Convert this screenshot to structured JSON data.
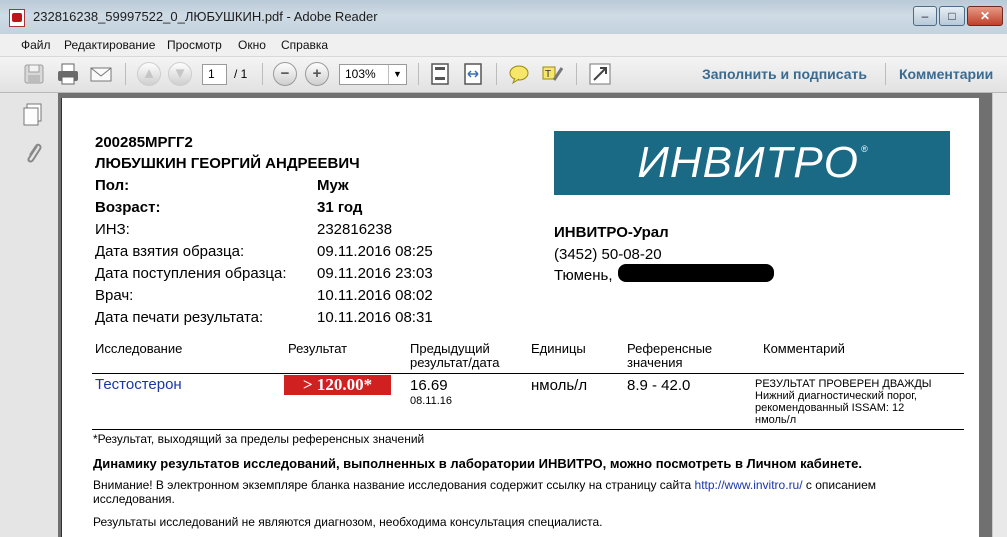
{
  "window": {
    "title": "232816238_59997522_0_ЛЮБУШКИН.pdf - Adobe Reader"
  },
  "menu": [
    "Файл",
    "Редактирование",
    "Просмотр",
    "Окно",
    "Справка"
  ],
  "toolbar": {
    "page_current": "1",
    "page_total": "/ 1",
    "zoom": "103%",
    "fill_sign": "Заполнить и подписать",
    "comments": "Комментарии"
  },
  "report": {
    "id": "200285МРГГ2",
    "patient": "ЛЮБУШКИН ГЕОРГИЙ АНДРЕЕВИЧ",
    "fields": [
      {
        "label": "Пол:",
        "value": "Муж",
        "bold": true
      },
      {
        "label": "Возраст:",
        "value": "31 год",
        "bold": true
      },
      {
        "label": "ИНЗ:",
        "value": "232816238",
        "bold": false
      },
      {
        "label": "Дата взятия образца:",
        "value": "09.11.2016 08:25",
        "bold": false
      },
      {
        "label": "Дата поступления образца:",
        "value": "09.11.2016 23:03",
        "bold": false
      },
      {
        "label": "Врач:",
        "value": "10.11.2016 08:02",
        "bold": false
      },
      {
        "label": "Дата печати результата:",
        "value": "10.11.2016 08:31",
        "bold": false
      }
    ],
    "logo_text": "ИНВИТРО",
    "logo_mark": "®",
    "lab": {
      "name": "ИНВИТРО-Урал",
      "phone": "(3452) 50-08-20",
      "city": "Тюмень,"
    },
    "table_headers": {
      "test": "Исследование",
      "result": "Результат",
      "prev_1": "Предыдущий",
      "prev_2": "результат/дата",
      "units": "Единицы",
      "ref_1": "Референсные",
      "ref_2": "значения",
      "comment": "Комментарий"
    },
    "row": {
      "test": "Тестостерон",
      "result": "> 120.00*",
      "prev_value": "16.69",
      "prev_date": "08.11.16",
      "units": "нмоль/л",
      "ref": "8.9 - 42.0",
      "comment_lines": [
        "РЕЗУЛЬТАТ ПРОВЕРЕН ДВАЖДЫ",
        "Нижний диагностический порог,",
        "рекомендованный ISSAM: 12",
        "нмоль/л"
      ]
    },
    "footnote": "*Результат, выходящий за пределы референсных значений",
    "dynamics": "Динамику результатов исследований, выполненных в лаборатории ИНВИТРО, можно посмотреть в Личном кабинете.",
    "attention_1": "Внимание! В электронном экземпляре бланка название исследования содержит ссылку на страницу сайта ",
    "attention_link": "http://www.invitro.ru/",
    "attention_2": " с описанием",
    "attention_3": "исследования.",
    "disclaimer": "Результаты исследований не являются диагнозом, необходима консультация специалиста."
  },
  "colors": {
    "logo_bg": "#1a6a85",
    "result_bg": "#d12020",
    "link": "#1a36a8",
    "toolbar_link": "#3b6a8f"
  }
}
